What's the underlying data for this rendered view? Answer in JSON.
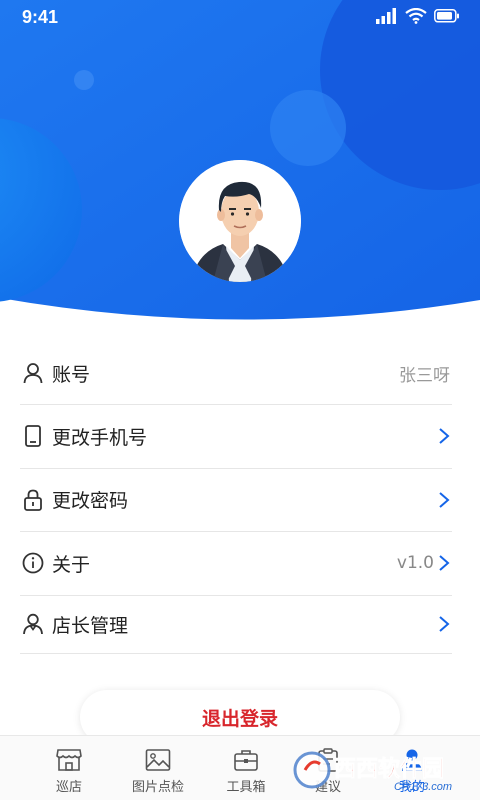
{
  "status_bar": {
    "time": "9:41"
  },
  "profile": {
    "avatar_alt": "avatar"
  },
  "menu": {
    "items": [
      {
        "label": "账号",
        "value": "张三呀",
        "icon": "user-icon"
      },
      {
        "label": "更改手机号",
        "icon": "phone-icon"
      },
      {
        "label": "更改密码",
        "icon": "lock-icon"
      },
      {
        "label": "关于",
        "value": "v1.0",
        "icon": "info-icon"
      },
      {
        "label": "店长管理",
        "icon": "manager-icon"
      }
    ]
  },
  "logout_label": "退出登录",
  "tabbar": {
    "tabs": [
      {
        "label": "巡店",
        "icon": "store-icon"
      },
      {
        "label": "图片点检",
        "icon": "image-icon"
      },
      {
        "label": "工具箱",
        "icon": "toolbox-icon"
      },
      {
        "label": "建议",
        "icon": "clipboard-icon"
      },
      {
        "label": "我的",
        "icon": "person-icon"
      }
    ],
    "active_index": 4
  },
  "watermark": {
    "text_main": "西西软件园",
    "text_sub": "CR173.com"
  },
  "colors": {
    "primary": "#1565e8",
    "danger": "#d8262c"
  }
}
